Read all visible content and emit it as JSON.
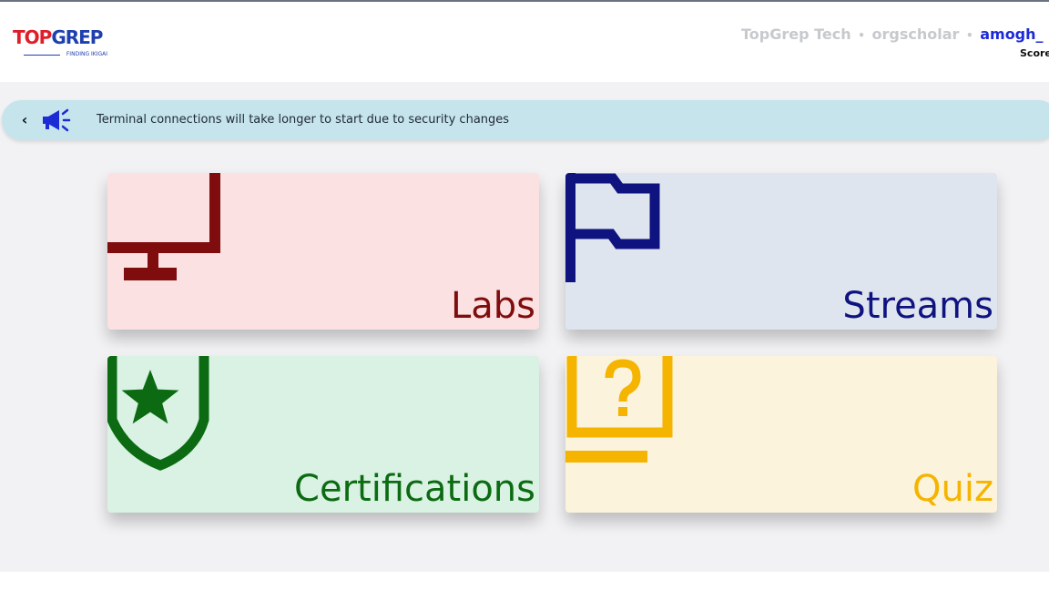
{
  "header": {
    "logo": {
      "word_part1": "TOP",
      "word_part2": "GREP",
      "tagline": "FINDING IKIGAI"
    },
    "breadcrumb": {
      "org": "TopGrep Tech",
      "sub": "orgscholar",
      "separator": "•",
      "user": "amogh_"
    },
    "score_label": "Score"
  },
  "banner": {
    "back_icon": "chevron-left-icon",
    "icon": "megaphone-icon",
    "message": "Terminal connections will take longer to start due to security changes"
  },
  "cards": [
    {
      "label": "Labs",
      "icon": "monitor-icon",
      "color": "#7f0d0d",
      "background": "#fbe1e2"
    },
    {
      "label": "Streams",
      "icon": "flag-icon",
      "color": "#0f137f",
      "background": "#dfe5ee"
    },
    {
      "label": "Certifications",
      "icon": "shield-star-icon",
      "color": "#0c6b12",
      "background": "#d9f2e3"
    },
    {
      "label": "Quiz",
      "icon": "quiz-monitor-icon",
      "color": "#f4b400",
      "background": "#fcf3dc"
    }
  ],
  "colors": {
    "accent_blue": "#1d2bd6",
    "banner_bg": "#c6e4ec",
    "page_bg": "#f2f2f4"
  }
}
